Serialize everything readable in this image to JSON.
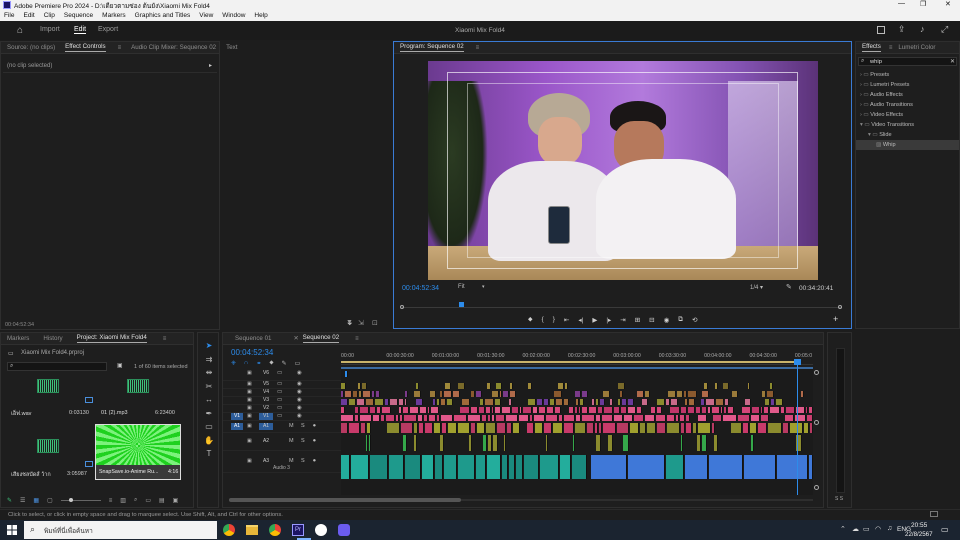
{
  "titlebar": {
    "app_title": "Adobe Premiere Pro 2024 - D:\\เดียวตามซ่อง ต้นยัง\\Xiaomi Mix Fold4"
  },
  "menubar": [
    "File",
    "Edit",
    "Clip",
    "Sequence",
    "Markers",
    "Graphics and Titles",
    "View",
    "Window",
    "Help"
  ],
  "header": {
    "workspaces": [
      "Import",
      "Edit",
      "Export"
    ],
    "active_workspace": "Edit",
    "project_title": "Xiaomi Mix Fold4"
  },
  "source_panel": {
    "tabs": [
      "Source: (no clips)",
      "Effect Controls",
      "Audio Clip Mixer: Sequence 02",
      "Text"
    ],
    "no_clip": "(no clip selected)",
    "timecode": "00:04:52:34"
  },
  "program": {
    "tab": "Program: Sequence 02",
    "timecode": "00:04:52:34",
    "fit": "Fit",
    "resolution": "1/4",
    "duration": "00:34:20:41",
    "playhead_fraction": 0.135
  },
  "effects": {
    "tabs": [
      "Effects",
      "Lumetri Color"
    ],
    "search": "whip",
    "items": [
      {
        "label": "Presets",
        "level": 0
      },
      {
        "label": "Lumetri Presets",
        "level": 0
      },
      {
        "label": "Audio Effects",
        "level": 0
      },
      {
        "label": "Audio Transitions",
        "level": 0
      },
      {
        "label": "Video Effects",
        "level": 0
      },
      {
        "label": "Video Transitions",
        "level": 0
      },
      {
        "label": "Slide",
        "level": 1
      },
      {
        "label": "Whip",
        "level": 2
      }
    ]
  },
  "project": {
    "tabs": [
      "Markers",
      "History",
      "Project: Xiaomi Mix Fold4"
    ],
    "file": "Xiaomi Mix Fold4.prproj",
    "selection": "1 of 60 items selected",
    "items": [
      {
        "name": "เอ็ฟ.wav",
        "dur": "0:03130"
      },
      {
        "name": "01 (2).mp3",
        "dur": "6:23400"
      },
      {
        "name": "เสียงชลบัดส์ ว้าก",
        "dur": "3:05987"
      },
      {
        "name": "SnapSave.io-Anime Ru...",
        "dur": "4:16"
      }
    ]
  },
  "timeline": {
    "tabs": [
      "Sequence 01",
      "Sequence 02"
    ],
    "timecode": "00:04:52:34",
    "ruler": [
      "00:00",
      "00:00:30:00",
      "00:01:00:00",
      "00:01:30:00",
      "00:02:00:00",
      "00:02:30:00",
      "00:03:00:00",
      "00:03:30:00",
      "00:04:00:00",
      "00:04:30:00",
      "00:05:0"
    ],
    "video_tracks": [
      "V6",
      "V5",
      "V4",
      "V3",
      "V2",
      "V1"
    ],
    "audio_tracks": [
      "A1",
      "A2",
      "A3"
    ],
    "audio3_label": "Audio 3",
    "meter": "S S"
  },
  "statusbar": {
    "hint": "Click to select, or click in empty space and drag to marquee select. Use Shift, Alt, and Ctrl for other options."
  },
  "taskbar": {
    "search_placeholder": "พิมพ์ที่นี่เพื่อค้นหา",
    "lang": "ENG",
    "time": "20:55",
    "date": "22/8/2567"
  },
  "colors": {
    "accent": "#2d8ceb",
    "clip_pink": "#d6477a",
    "clip_olive": "#8b8b2e",
    "clip_teal": "#1e9a8c",
    "clip_blue": "#3f78d8",
    "clip_green": "#35a84a"
  }
}
